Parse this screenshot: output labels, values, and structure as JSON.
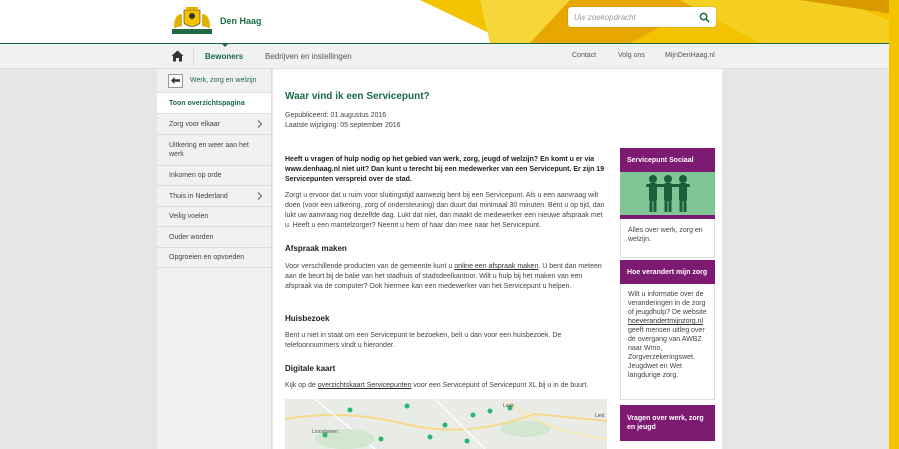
{
  "header": {
    "brand": "Den Haag",
    "search_placeholder": "Uw zoekopdracht"
  },
  "nav": {
    "items": [
      "Bewoners",
      "Bedrijven en instellingen"
    ],
    "right_items": [
      "Contact",
      "Volg ons",
      "MijnDenHaag.nl"
    ]
  },
  "sidebar": {
    "back_label": "Werk, zorg en welzijn",
    "items": [
      "Toon overzichtspagina",
      "Zorg voor elkaar",
      "Uitkering en weer aan het werk",
      "Inkomen op orde",
      "Thuis in Nederland",
      "Veilig voelen",
      "Ouder worden",
      "Opgroeien en opvoeden"
    ]
  },
  "article": {
    "title": "Waar vind ik een Servicepunt?",
    "published": "Gepubliceerd: 01 augustus 2016",
    "modified": "Laatste wijziging: 05 september 2016",
    "intro": "Heeft u vragen of hulp nodig op het gebied van werk, zorg, jeugd of welzijn? En komt u er via www.denhaag.nl niet uit? Dan kunt u terecht bij een medewerker van een Servicepunt. Er zijn 19 Servicepunten verspreid over de stad.",
    "p1": "Zorgt u ervoor dat u ruim voor sluitingstijd aanwezig bent bij een Servicepunt. Als u een aanvraag wilt doen (voor een uitkering, zorg of ondersteuning) dan duurt dat minimaal 30 minuten. Bent u op tijd, dan lukt uw aanvraag nog dezelfde dag. Lukt dat niet, dan maakt de medewerker een nieuwe afspraak met u. Heeft u een mantelzorger? Neemt u hem of haar dan mee naar het Servicepunt.",
    "h_afspraak": "Afspraak maken",
    "p2_a": "Voor verschillende producten van de gemeente kunt u ",
    "p2_link": "online een afspraak maken",
    "p2_b": ". U bent dan meteen aan de beurt bij de balie van het stadhuis of stadsdeelkantoor. Wilt u hulp bij het maken van een afspraak via de computer? Ook hiermee kan een medewerker van het Servicepunt u helpen.",
    "h_huisbezoek": "Huisbezoek",
    "p3": "Bent u niet in staat om een Servicepunt te bezoeken, belt u dan voor een huisbezoek. De telefoonnummers vindt u hieronder.",
    "h_kaart": "Digitale kaart",
    "p4_a": "Kijk op de ",
    "p4_link": "overzichtskaart Servicepunten",
    "p4_b": " voor een Servicepunt of Servicepunt XL bij u in de buurt.",
    "map_labels": [
      "Loosduinen",
      "Laak",
      "Leid"
    ]
  },
  "right": {
    "box1_title": "Servicepunt Sociaal",
    "box1_text": "Alles over werk, zorg en welzijn.",
    "box2_title": "Hoe verandert mijn zorg",
    "box2_text_a": "Wilt u informatie over de veranderingen in de zorg of jeugdhulp? De website ",
    "box2_link": "hoeverandertmijnzorg.nl",
    "box2_text_b": " geeft mensen uitleg over de overgang van AWBZ naar Wmo, Zorgverzekeringswet, Jeugdwet en Wet langdurige zorg.",
    "box3_title": "Vragen over werk, zorg en jeugd"
  },
  "colors": {
    "green": "#1d6b45",
    "purple": "#7d1b73",
    "yellow": "#f3c300",
    "light_green": "#80c596"
  }
}
